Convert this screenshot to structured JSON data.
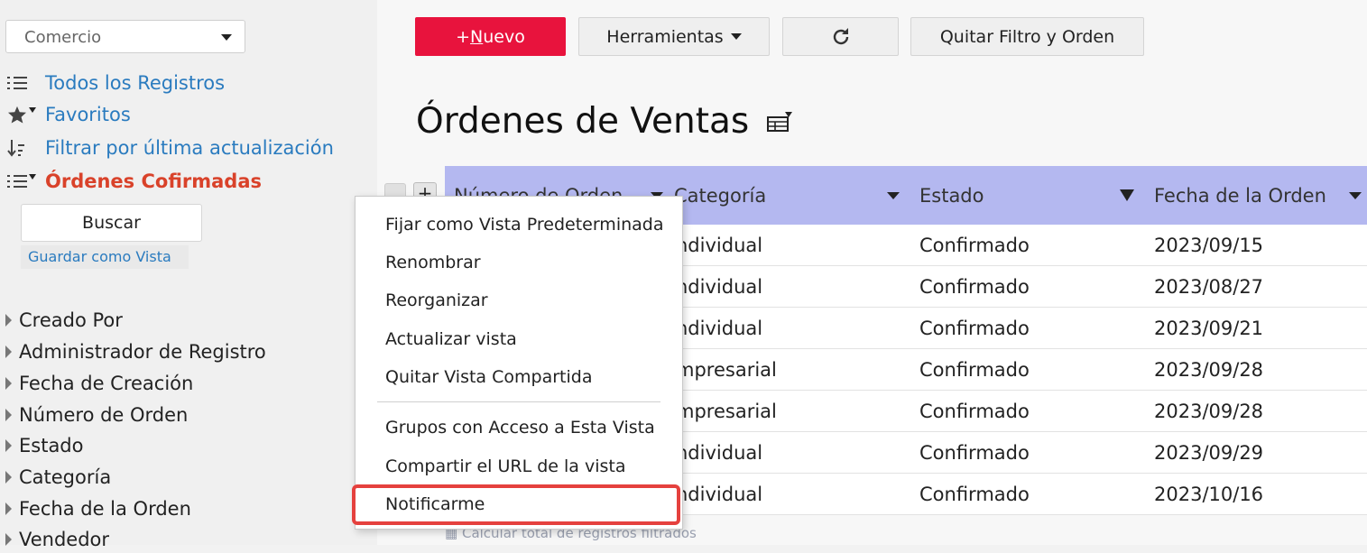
{
  "sidebar": {
    "app_select": "Comercio",
    "views": [
      {
        "label": "Todos los Registros"
      },
      {
        "label": "Favoritos"
      },
      {
        "label": "Filtrar por última actualización"
      },
      {
        "label": "Órdenes Cofirmadas"
      }
    ],
    "search_label": "Buscar",
    "save_view_label": "Guardar como Vista",
    "fields": [
      "Creado Por",
      "Administrador de Registro",
      "Fecha de Creación",
      "Número de Orden",
      "Estado",
      "Categoría",
      "Fecha de la Orden",
      "Vendedor"
    ]
  },
  "toolbar": {
    "new_prefix": "+",
    "new_underline": "N",
    "new_rest": "uevo",
    "tools_label": "Herramientas",
    "refresh_icon": "refresh-icon",
    "clear_filter_label": "Quitar Filtro y Orden"
  },
  "page": {
    "title": "Órdenes de Ventas"
  },
  "table": {
    "columns": [
      "Número de Orden",
      "Categoría",
      "Estado",
      "Fecha de la Orden"
    ],
    "rows": [
      {
        "categoria": "ndividual",
        "estado": "Confirmado",
        "fecha": "2023/09/15"
      },
      {
        "categoria": "ndividual",
        "estado": "Confirmado",
        "fecha": "2023/08/27"
      },
      {
        "categoria": "ndividual",
        "estado": "Confirmado",
        "fecha": "2023/09/21"
      },
      {
        "categoria": "mpresarial",
        "estado": "Confirmado",
        "fecha": "2023/09/28"
      },
      {
        "categoria": "mpresarial",
        "estado": "Confirmado",
        "fecha": "2023/09/28"
      },
      {
        "categoria": "ndividual",
        "estado": "Confirmado",
        "fecha": "2023/09/29"
      },
      {
        "categoria": "ndividual",
        "estado": "Confirmado",
        "fecha": "2023/10/16"
      }
    ],
    "footer_note": "Calcular total de registros filtrados"
  },
  "context_menu": {
    "items": [
      "Fijar como Vista Predeterminada",
      "Renombrar",
      "Reorganizar",
      "Actualizar vista",
      "Quitar Vista Compartida",
      "Grupos con Acceso a Esta Vista",
      "Compartir el URL de la vista",
      "Notificarme"
    ],
    "highlight_color": "#e5413e"
  },
  "colors": {
    "accent_new": "#e8133d",
    "link": "#2a7bbf",
    "active_view": "#d9422a",
    "table_header": "#b4b8f0"
  }
}
